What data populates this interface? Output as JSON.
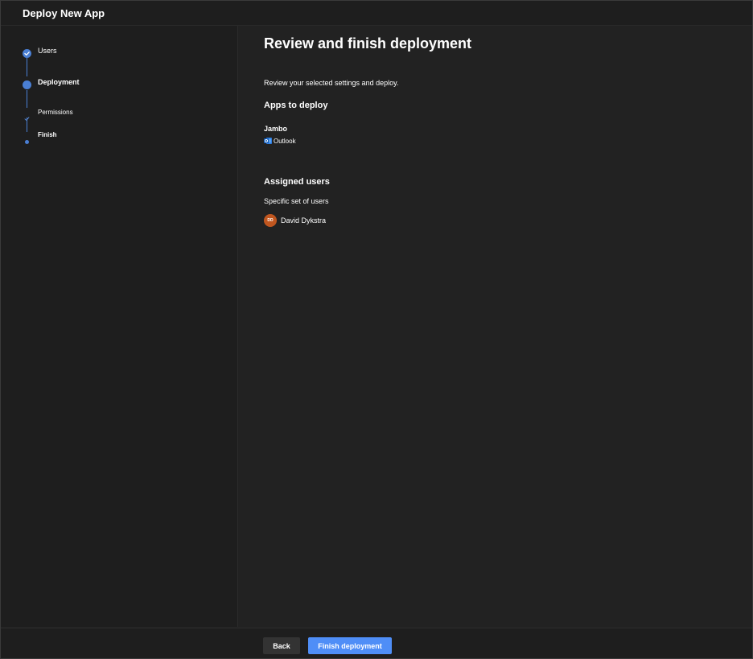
{
  "window": {
    "title": "Deploy New App"
  },
  "steps": [
    {
      "label": "Users",
      "state": "completed"
    },
    {
      "label": "Deployment",
      "state": "current"
    },
    {
      "label": "Permissions",
      "state": "sub-completed"
    },
    {
      "label": "Finish",
      "state": "sub-current"
    }
  ],
  "main": {
    "heading": "Review and finish deployment",
    "intro": "Review your selected settings and deploy.",
    "apps_section": {
      "title": "Apps to deploy",
      "app_name": "Jambo",
      "host": "Outlook",
      "host_icon": "outlook-icon"
    },
    "users_section": {
      "title": "Assigned users",
      "description": "Specific set of users",
      "user": {
        "initials": "DD",
        "name": "David Dykstra",
        "avatar_color": "#c0561f"
      }
    }
  },
  "footer": {
    "back_label": "Back",
    "finish_label": "Finish deployment"
  },
  "colors": {
    "accent": "#4f8ef7",
    "step_accent": "#4a7fd4",
    "background": "#222222",
    "sidebar": "#1e1e1e"
  }
}
